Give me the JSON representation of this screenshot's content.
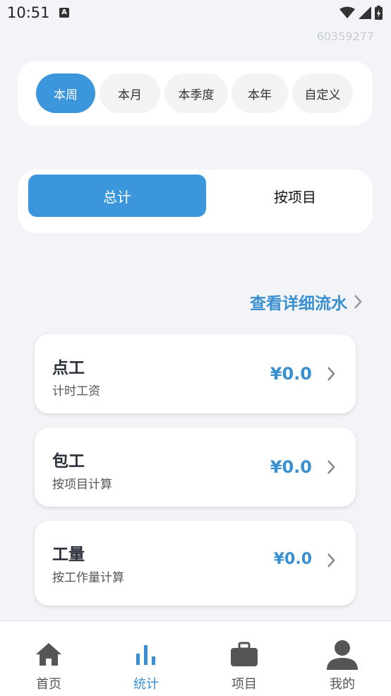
{
  "status": {
    "time": "10:51",
    "a_icon": "A"
  },
  "user_id": "60359277",
  "periods": [
    "本周",
    "本月",
    "本季度",
    "本年",
    "自定义"
  ],
  "mode_tabs": {
    "total": "总计",
    "by_project": "按项目"
  },
  "detail_link": "查看详细流水",
  "wages": [
    {
      "title": "点工",
      "subtitle": "计时工资",
      "amount": "¥0.0"
    },
    {
      "title": "包工",
      "subtitle": "按项目计算",
      "amount": "¥0.0"
    },
    {
      "title": "工量",
      "subtitle": "按工作量计算",
      "amount": "¥0.0"
    }
  ],
  "nav": [
    "首页",
    "统计",
    "项目",
    "我的"
  ],
  "colors": {
    "accent": "#3b96db",
    "background": "#f2f4f8"
  }
}
